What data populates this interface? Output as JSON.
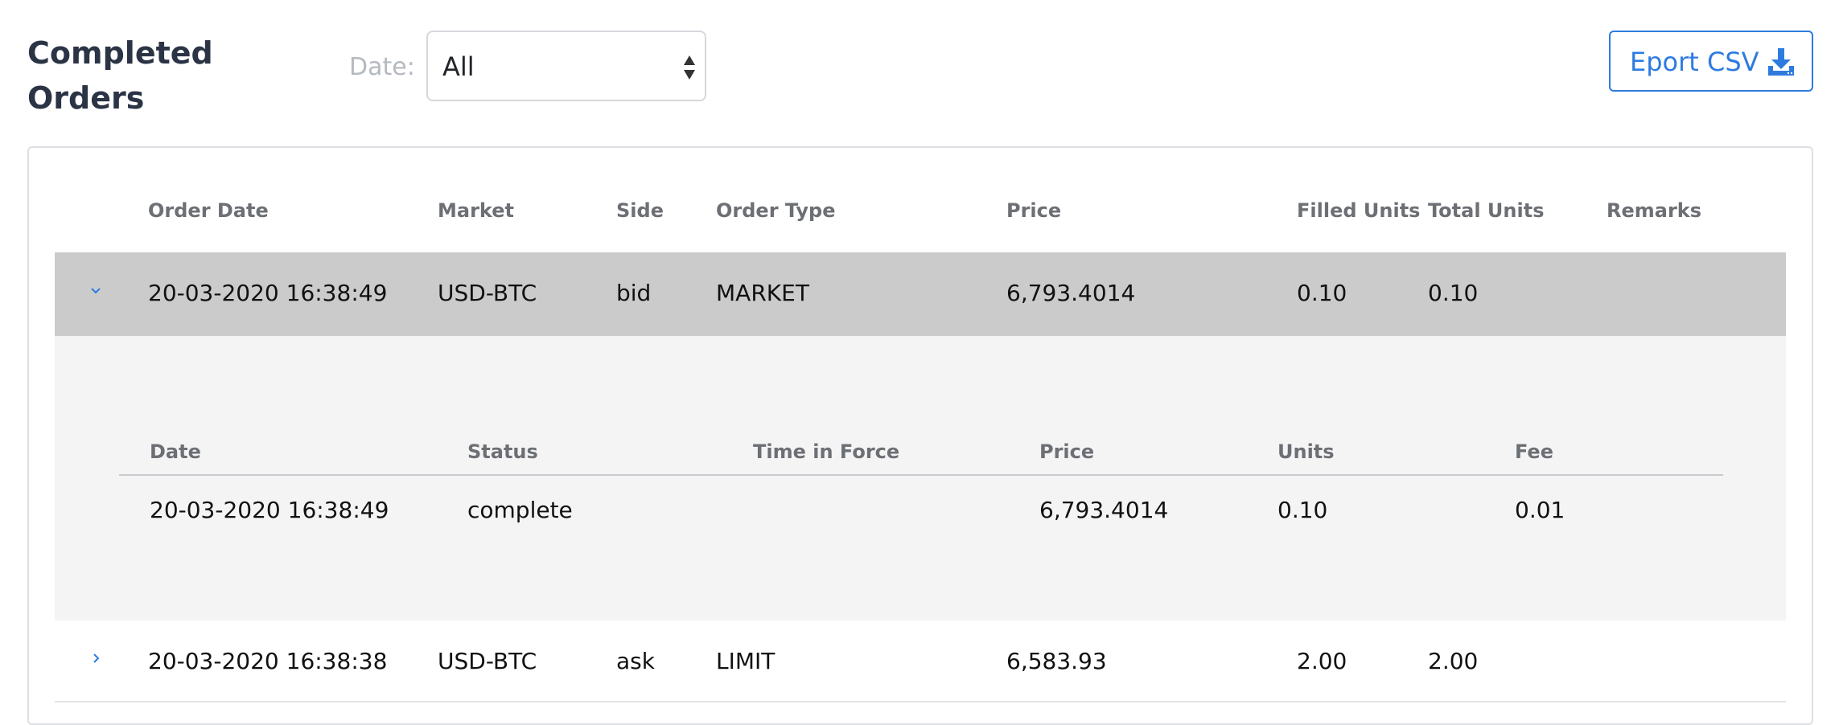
{
  "page": {
    "title": "Completed Orders"
  },
  "filter": {
    "label": "Date:",
    "selected": "All"
  },
  "export": {
    "label": "Eport CSV",
    "icon": "download-icon"
  },
  "colors": {
    "accent": "#2e7be0",
    "expanded_row_bg": "#cbcbcb",
    "detail_bg": "#f4f4f4"
  },
  "table": {
    "headers": [
      "Order Date",
      "Market",
      "Side",
      "Order Type",
      "Price",
      "Filled Units",
      "Total Units",
      "Remarks"
    ],
    "rows": [
      {
        "expanded": true,
        "cells": [
          "20-03-2020 16:38:49",
          "USD-BTC",
          "bid",
          "MARKET",
          "6,793.4014",
          "0.10",
          "0.10",
          ""
        ],
        "details": {
          "headers": [
            "Date",
            "Status",
            "Time in Force",
            "Price",
            "Units",
            "Fee"
          ],
          "rows": [
            [
              "20-03-2020 16:38:49",
              "complete",
              "",
              "6,793.4014",
              "0.10",
              "0.01"
            ]
          ]
        }
      },
      {
        "expanded": false,
        "cells": [
          "20-03-2020 16:38:38",
          "USD-BTC",
          "ask",
          "LIMIT",
          "6,583.93",
          "2.00",
          "2.00",
          ""
        ]
      }
    ]
  }
}
